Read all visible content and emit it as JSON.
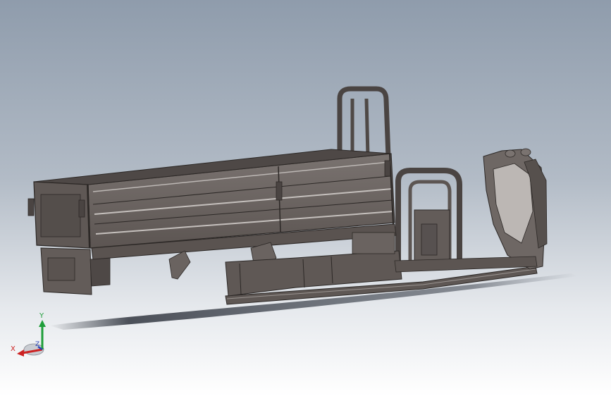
{
  "view": {
    "background_top": "#8f9cac",
    "background_bottom": "#ffffff",
    "model_fill": "#6b6461",
    "model_edge": "#2c2826",
    "model_highlight": "#aaa5a2",
    "shadow": "#3a3f48"
  },
  "triad": {
    "x_label": "X",
    "y_label": "Y",
    "z_label": "Z",
    "x_color": "#cc2222",
    "y_color": "#1f9e3a",
    "z_color": "#2a44b8"
  }
}
